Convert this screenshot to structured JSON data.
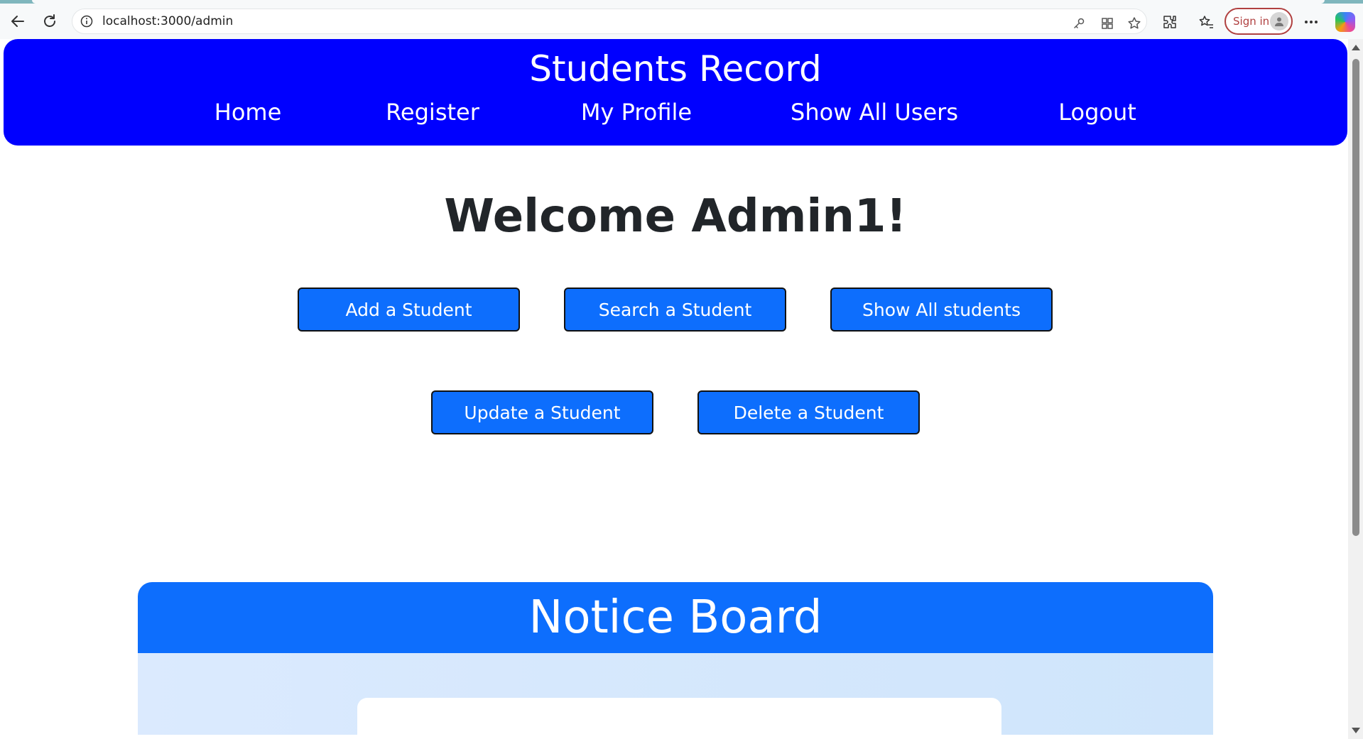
{
  "browser": {
    "url": "localhost:3000/admin",
    "sign_in_label": "Sign in"
  },
  "site": {
    "title": "Students Record",
    "nav": [
      "Home",
      "Register",
      "My Profile",
      "Show All Users",
      "Logout"
    ]
  },
  "main": {
    "welcome": "Welcome Admin1!",
    "actions": [
      "Add a Student",
      "Search a Student",
      "Show All students",
      "Update a Student",
      "Delete a Student"
    ]
  },
  "notice_board": {
    "title": "Notice Board"
  },
  "colors": {
    "header_bg": "#0000ff",
    "button_bg": "#0d6efd",
    "notice_header_bg": "#0d6efd",
    "notice_body_bg": "#dbeafe"
  }
}
